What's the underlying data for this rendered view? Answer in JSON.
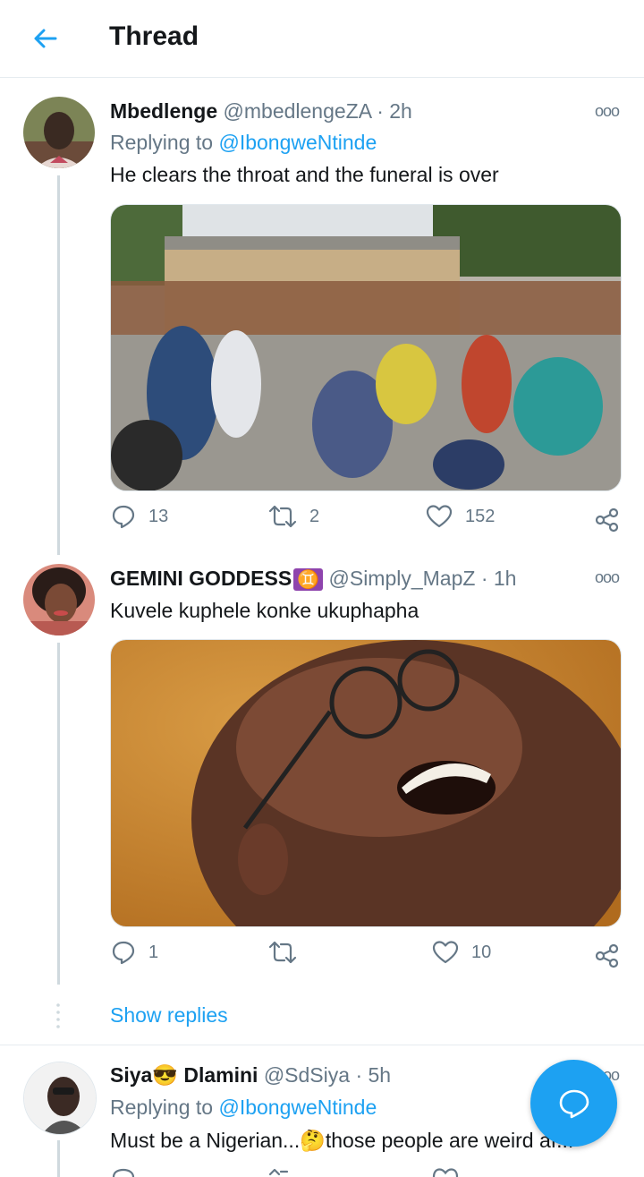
{
  "header": {
    "title": "Thread"
  },
  "tweets": [
    {
      "name": "Mbedlenge",
      "handle": "@mbedlengeZA",
      "time": "· 2h",
      "reply_prefix": "Replying to ",
      "reply_to": "@IbongweNtinde",
      "text": "He clears the throat and the funeral is over",
      "replies": "13",
      "retweets": "2",
      "likes": "152"
    },
    {
      "name": "GEMINI GODDESS",
      "name_emoji": "♊",
      "handle": "@Simply_MapZ",
      "time": "· 1h",
      "text": "Kuvele kuphele konke ukuphapha",
      "replies": "1",
      "retweets": "",
      "likes": "10"
    },
    {
      "name_first": "Siya",
      "name_emoji": "😎",
      "name_last": "Dlamini",
      "handle": "@SdSiya",
      "time": "· 5h",
      "reply_prefix": "Replying to ",
      "reply_to": "@IbongweNtinde",
      "text_a": "Must be a Nigerian...",
      "text_emoji": "🤔",
      "text_b": "those people are weird af..."
    }
  ],
  "show_replies": "Show replies",
  "more_glyph": "ooo",
  "colors": {
    "accent": "#1da1f2",
    "secondary": "#657786",
    "divider": "#e6ecf0"
  }
}
